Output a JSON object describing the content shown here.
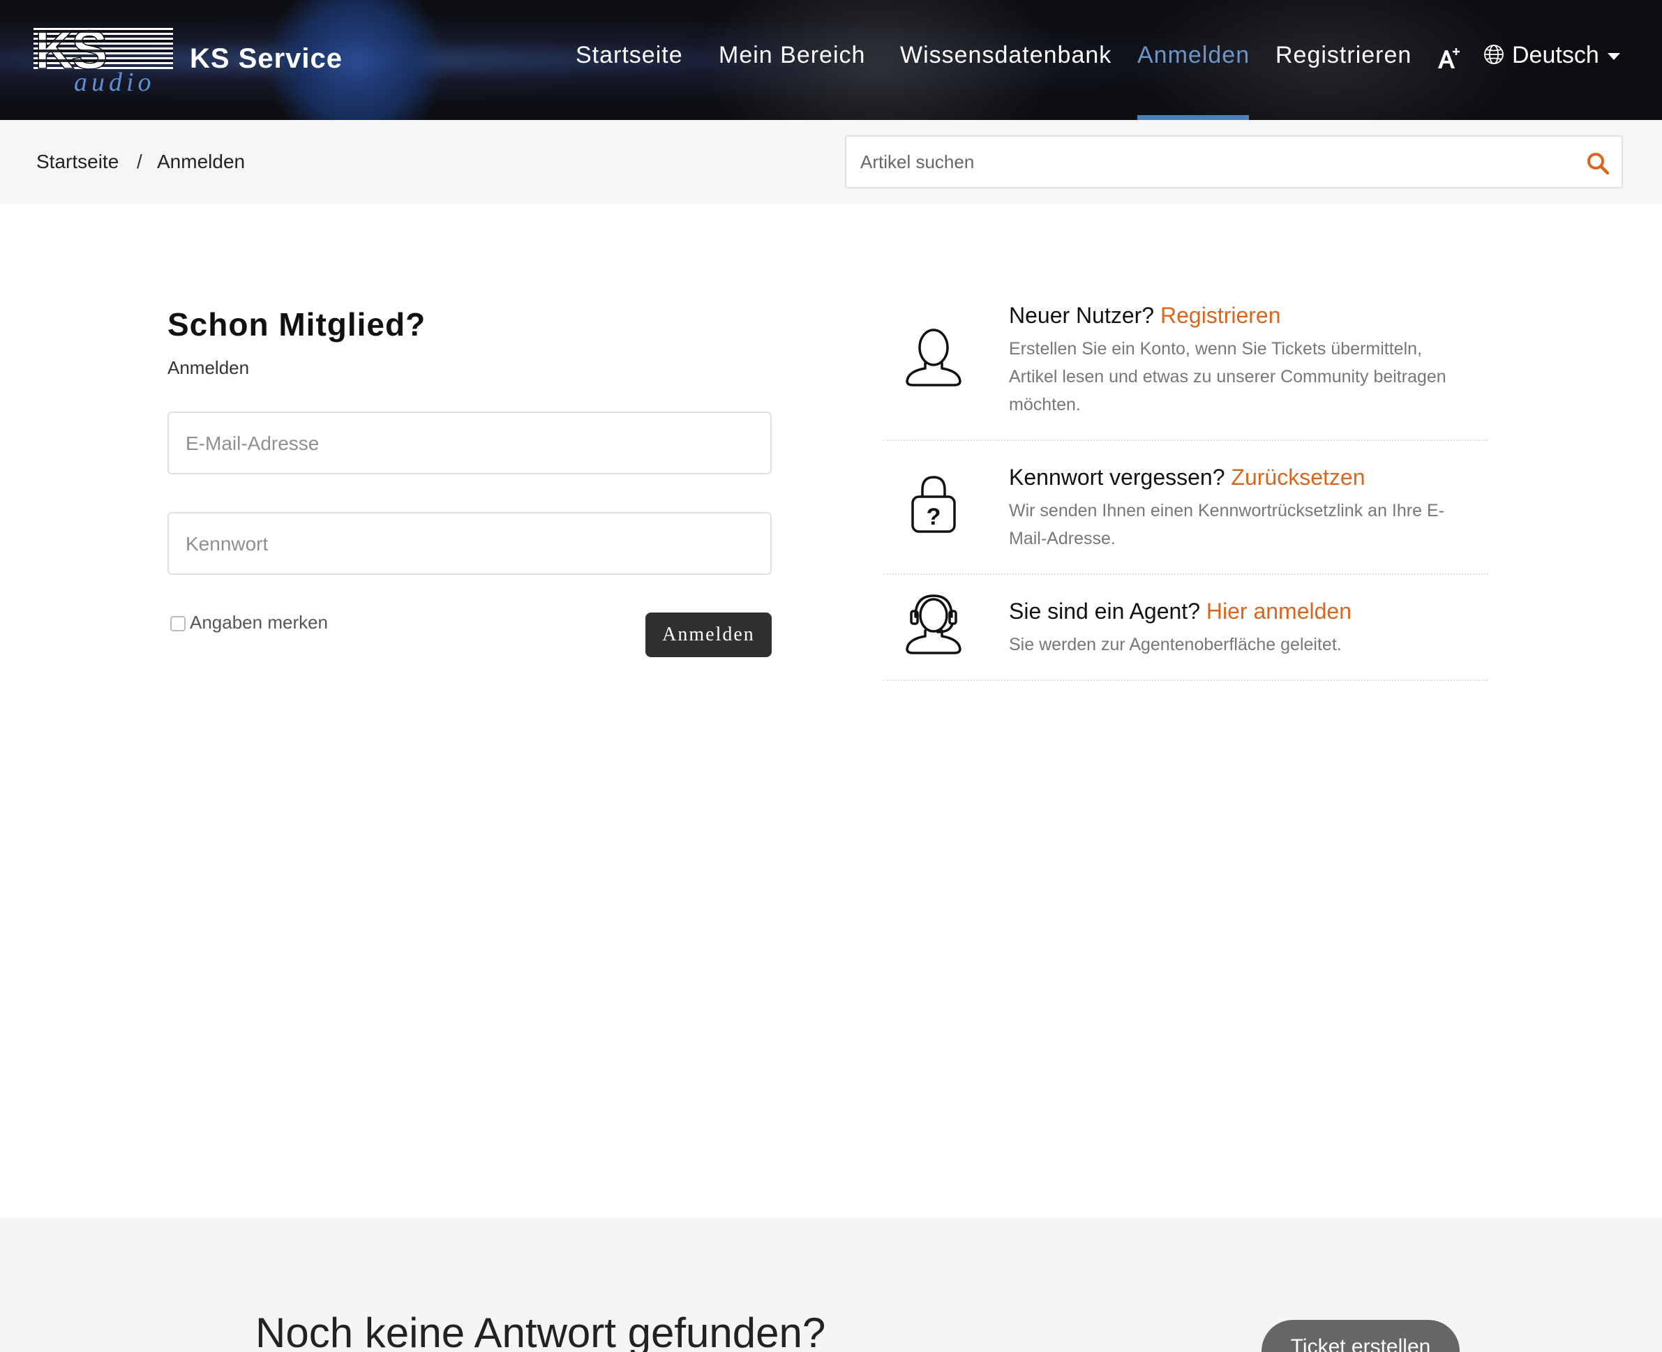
{
  "header": {
    "logo_text": "KS audio",
    "brand_name": "KS Service",
    "nav": [
      {
        "label": "Startseite",
        "active": false
      },
      {
        "label": "Mein Bereich",
        "active": false
      },
      {
        "label": "Wissensdatenbank",
        "active": false
      },
      {
        "label": "Anmelden",
        "active": true
      },
      {
        "label": "Registrieren",
        "active": false
      }
    ],
    "font_size_icon": "font-size-icon",
    "language": "Deutsch",
    "colors": {
      "active_nav": "#6f95c6",
      "underline": "#4f7fb7"
    }
  },
  "breadcrumb": {
    "items": [
      "Startseite",
      "Anmelden"
    ],
    "separator": "/"
  },
  "search": {
    "placeholder": "Artikel suchen",
    "icon": "search-icon",
    "icon_color": "#d9661f"
  },
  "login": {
    "title": "Schon Mitglied?",
    "subtitle": "Anmelden",
    "email_placeholder": "E-Mail-Adresse",
    "password_placeholder": "Kennwort",
    "remember_label": "Angaben merken",
    "submit_label": "Anmelden"
  },
  "info_items": [
    {
      "icon": "user-icon",
      "question": "Neuer Nutzer?",
      "link": "Registrieren",
      "description": "Erstellen Sie ein Konto, wenn Sie Tickets übermitteln, Artikel lesen und etwas zu unserer Community beitragen möchten."
    },
    {
      "icon": "lock-question-icon",
      "question": "Kennwort vergessen?",
      "link": "Zurücksetzen",
      "description": "Wir senden Ihnen einen Kennwortrücksetzlink an Ihre E-Mail-Adresse."
    },
    {
      "icon": "headset-agent-icon",
      "question": "Sie sind ein Agent?",
      "link": "Hier anmelden",
      "description": "Sie werden zur Agentenoberfläche geleitet."
    }
  ],
  "footer": {
    "title": "Noch keine Antwort gefunden?",
    "button": "Ticket erstellen"
  },
  "accent_color": "#d9661f"
}
